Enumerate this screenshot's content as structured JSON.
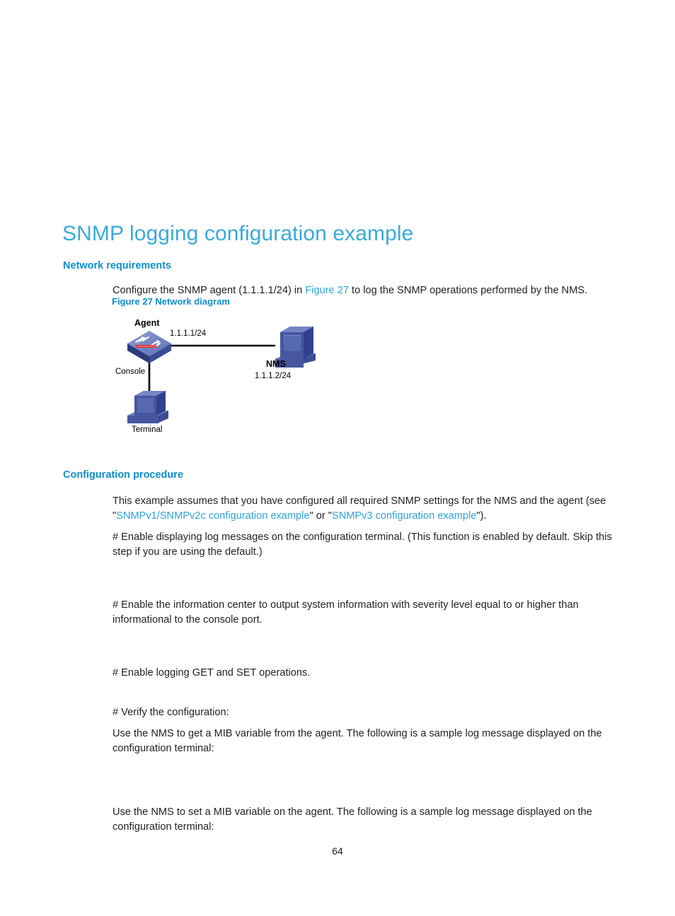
{
  "document": {
    "page_number": "64"
  },
  "headings": {
    "title": "SNMP logging configuration example",
    "network_requirements": "Network requirements",
    "configuration_procedure": "Configuration procedure"
  },
  "figure": {
    "caption": "Figure 27 Network diagram",
    "labels": {
      "agent": "Agent",
      "agent_ip": "1.1.1.1/24",
      "console": "Console",
      "nms": "NMS",
      "nms_ip": "1.1.1.2/24",
      "terminal": "Terminal"
    }
  },
  "body": {
    "intro": {
      "before_link": "Configure the SNMP agent (1.1.1.1/24) in ",
      "link": "Figure 27",
      "after_link": " to log the SNMP operations performed by the NMS."
    },
    "assumption": {
      "part1": "This example assumes that you have configured all required SNMP settings for the NMS and the agent (see \"",
      "link1": "SNMPv1/SNMPv2c configuration example",
      "part2": "\" or \"",
      "link2": "SNMPv3 configuration example",
      "part3": "\")."
    },
    "step_enable_display": "# Enable displaying log messages on the configuration terminal. (This function is enabled by default. Skip this step if you are using the default.)",
    "step_enable_infocenter": "# Enable the information center to output system information with severity level equal to or higher than informational to the console port.",
    "step_enable_logging": "# Enable logging GET and SET operations.",
    "step_verify": "# Verify the configuration:",
    "verify_get": "Use the NMS to get a MIB variable from the agent. The following is a sample log message displayed on the configuration terminal:",
    "verify_set": "Use the NMS to set a MIB variable on the agent. The following is a sample log message displayed on the configuration terminal:"
  },
  "colors": {
    "title_blue": "#3aa9dd",
    "heading_blue": "#0b8ecd",
    "link_blue": "#2fa3dc",
    "body_text": "#231f20",
    "device_blue_light": "#6c7fc0",
    "device_blue_mid": "#4a5aa8",
    "device_blue_dark": "#2f3a7a",
    "connector_black": "#000000",
    "accent_red": "#e03030"
  }
}
